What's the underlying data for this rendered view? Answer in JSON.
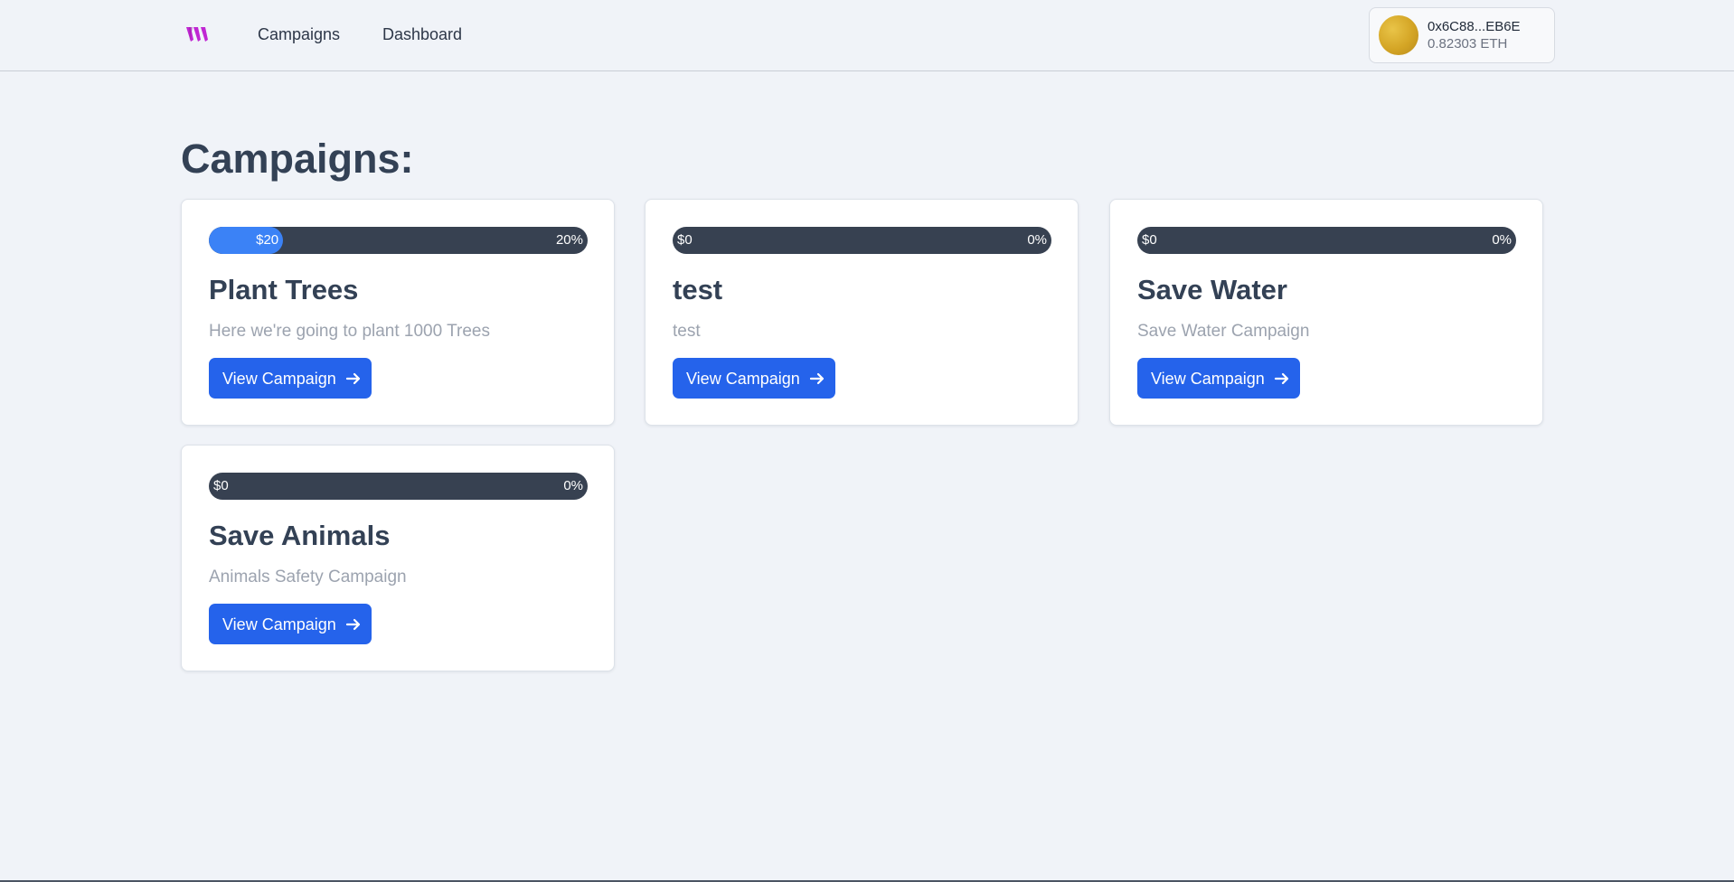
{
  "nav": {
    "logo_icon": "brand-logo-icon",
    "links": [
      {
        "label": "Campaigns"
      },
      {
        "label": "Dashboard"
      }
    ]
  },
  "wallet": {
    "address": "0x6C88...EB6E",
    "balance": "0.82303 ETH"
  },
  "page": {
    "title": "Campaigns:"
  },
  "colors": {
    "accent": "#2563eb",
    "progress_fill": "#3b82f6",
    "progress_track": "#374151",
    "logo": "#c026d3"
  },
  "campaigns": [
    {
      "amount": "$20",
      "percent_label": "20%",
      "progress": 20,
      "title": "Plant Trees",
      "description": "Here we're going to plant 1000 Trees",
      "button_label": "View Campaign"
    },
    {
      "amount": "$0",
      "percent_label": "0%",
      "progress": 0,
      "title": "test",
      "description": "test",
      "button_label": "View Campaign"
    },
    {
      "amount": "$0",
      "percent_label": "0%",
      "progress": 0,
      "title": "Save Water",
      "description": "Save Water Campaign",
      "button_label": "View Campaign"
    },
    {
      "amount": "$0",
      "percent_label": "0%",
      "progress": 0,
      "title": "Save Animals",
      "description": "Animals Safety Campaign",
      "button_label": "View Campaign"
    }
  ]
}
